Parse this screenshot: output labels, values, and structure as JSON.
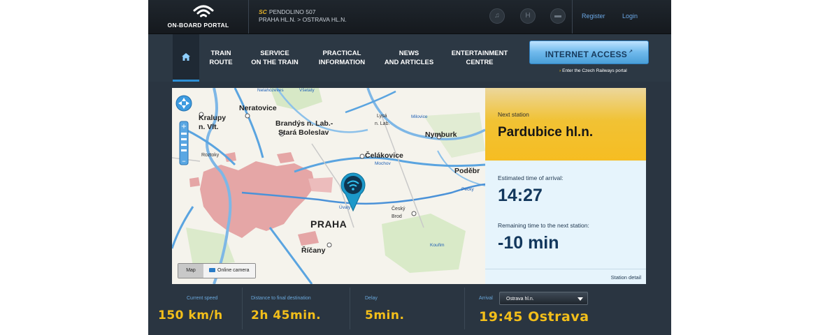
{
  "header": {
    "portal_label": "ON-BOARD PORTAL",
    "train_logo": "SC",
    "train_name": "PENDOLINO 507",
    "route": "PRAHA HL.N. > OSTRAVA HL.N.",
    "icons": [
      "music-icon",
      "hotel-icon",
      "book-icon"
    ],
    "register": "Register",
    "login": "Login"
  },
  "nav": {
    "items": [
      {
        "line1": "TRAIN",
        "line2": "ROUTE"
      },
      {
        "line1": "SERVICE",
        "line2": "ON THE TRAIN"
      },
      {
        "line1": "PRACTICAL",
        "line2": "INFORMATION"
      },
      {
        "line1": "NEWS",
        "line2": "AND ARTICLES"
      },
      {
        "line1": "ENTERTAINMENT",
        "line2": "CENTRE"
      }
    ],
    "internet_access": "INTERNET ACCESS",
    "czech_portal": "Enter the Czech Railways portal"
  },
  "map": {
    "labels": {
      "neratovice": "Neratovice",
      "kralupy": "Kralupy",
      "vlt": "n. Vlt.",
      "brandys": "Brandýs n. Lab.-",
      "stara": "Stará Boleslav",
      "lysa": "Lysá",
      "lysa2": "n. Lab.",
      "nymburk": "Nymburk",
      "celakovice": "Čelákovice",
      "podebr": "Poděbr",
      "roztoky": "Roztoky",
      "praha": "PRAHA",
      "cesky": "Český",
      "brod": "Brod",
      "ricany": "Říčany",
      "ovaly": "Úvaly",
      "milovice": "Milovice",
      "vsetaty": "Všetaty",
      "nelahozeves": "Nelahozeves",
      "mochov": "Mochov",
      "kourim": "Kouřim",
      "pecky": "Pečky"
    },
    "btn_map": "Map",
    "btn_camera": "Online camera"
  },
  "station": {
    "next_label": "Next station",
    "next_name": "Pardubice hl.n.",
    "eta_label": "Estimated time of arrival:",
    "eta": "14:27",
    "remaining_label": "Remaining time to the next station:",
    "remaining": "-10 min",
    "detail": "Station detail"
  },
  "stats": {
    "speed_label": "Current speed",
    "speed": "150 km/h",
    "distance_label": "Distance to final destination",
    "distance": "2h 45min.",
    "delay_label": "Delay",
    "delay": "5min.",
    "arrival_label": "Arrival",
    "arrival_select": "Ostrava hl.n.",
    "arrival": "19:45 Ostrava"
  }
}
